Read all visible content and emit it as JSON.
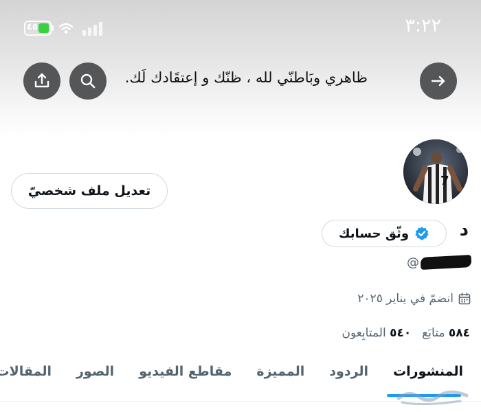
{
  "status_bar": {
    "time": "٣:٢٢",
    "battery_text": "٤٥"
  },
  "header": {
    "bio": "ظاهري وبَاطنّي لله ، ظنّك و إعتقَادك لَك."
  },
  "profile": {
    "edit_profile_label": "تعديل ملف شخصيّ",
    "display_name": "د",
    "verify_label": "وثّق حسابك",
    "handle_prefix": "@",
    "joined_text": "انضمّ في يناير ٢٠٢٥",
    "following_count": "٥٨٤",
    "following_label": "متابَع",
    "followers_count": "٥٤٠",
    "followers_label": "المتابِعون"
  },
  "tabs": [
    "المنشورات",
    "الردود",
    "المميزة",
    "مقاطع الفيديو",
    "الصور",
    "المقالات"
  ],
  "colors": {
    "accent": "#1d9bf0",
    "verified": "#1d9bf0",
    "header_button": "#555658",
    "battery": "#3ad13f"
  },
  "icons": {
    "back": "arrow-right-icon",
    "search": "search-icon",
    "share": "share-upload-icon",
    "calendar": "calendar-icon",
    "verified": "verified-badge-icon"
  }
}
